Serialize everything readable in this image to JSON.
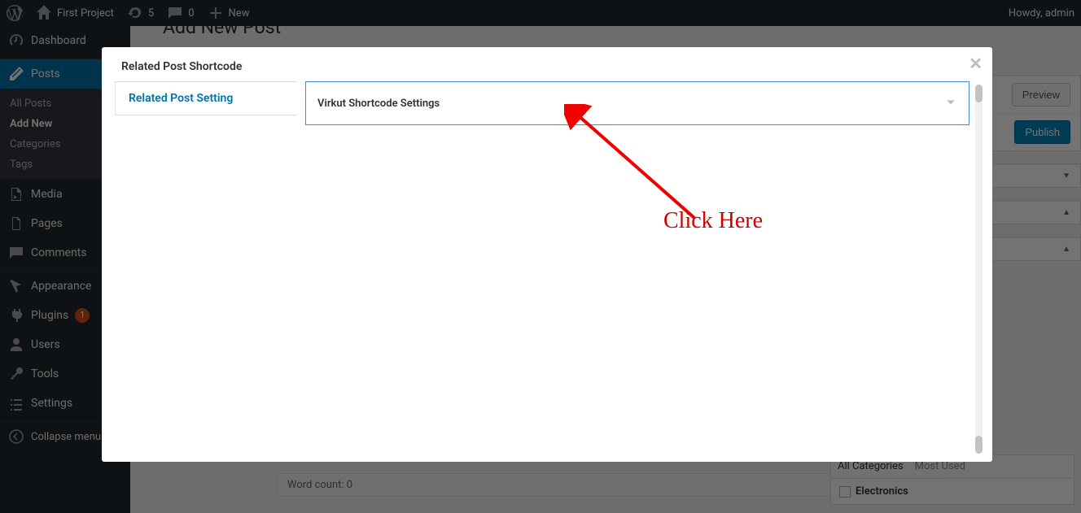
{
  "admin_bar": {
    "site_name": "First Project",
    "updates_count": "5",
    "comments_count": "0",
    "new_label": "New",
    "greeting": "Howdy, admin"
  },
  "sidebar": {
    "dashboard": "Dashboard",
    "posts": "Posts",
    "posts_submenu": {
      "all_posts": "All Posts",
      "add_new": "Add New",
      "categories": "Categories",
      "tags": "Tags"
    },
    "media": "Media",
    "pages": "Pages",
    "comments": "Comments",
    "appearance": "Appearance",
    "plugins": "Plugins",
    "plugins_badge": "1",
    "users": "Users",
    "tools": "Tools",
    "settings": "Settings",
    "collapse": "Collapse menu"
  },
  "page": {
    "title": "Add New Post",
    "preview_button": "Preview",
    "publish_button": "Publish",
    "word_count": "Word count: 0",
    "categories_tabs": {
      "all": "All Categories",
      "most_used": "Most Used"
    },
    "category_item": "Electronics"
  },
  "modal": {
    "header": "Related Post Shortcode",
    "tab_label": "Related Post Setting",
    "panel_title": "Virkut Shortcode Settings"
  },
  "annotation": {
    "text": "Click Here"
  }
}
